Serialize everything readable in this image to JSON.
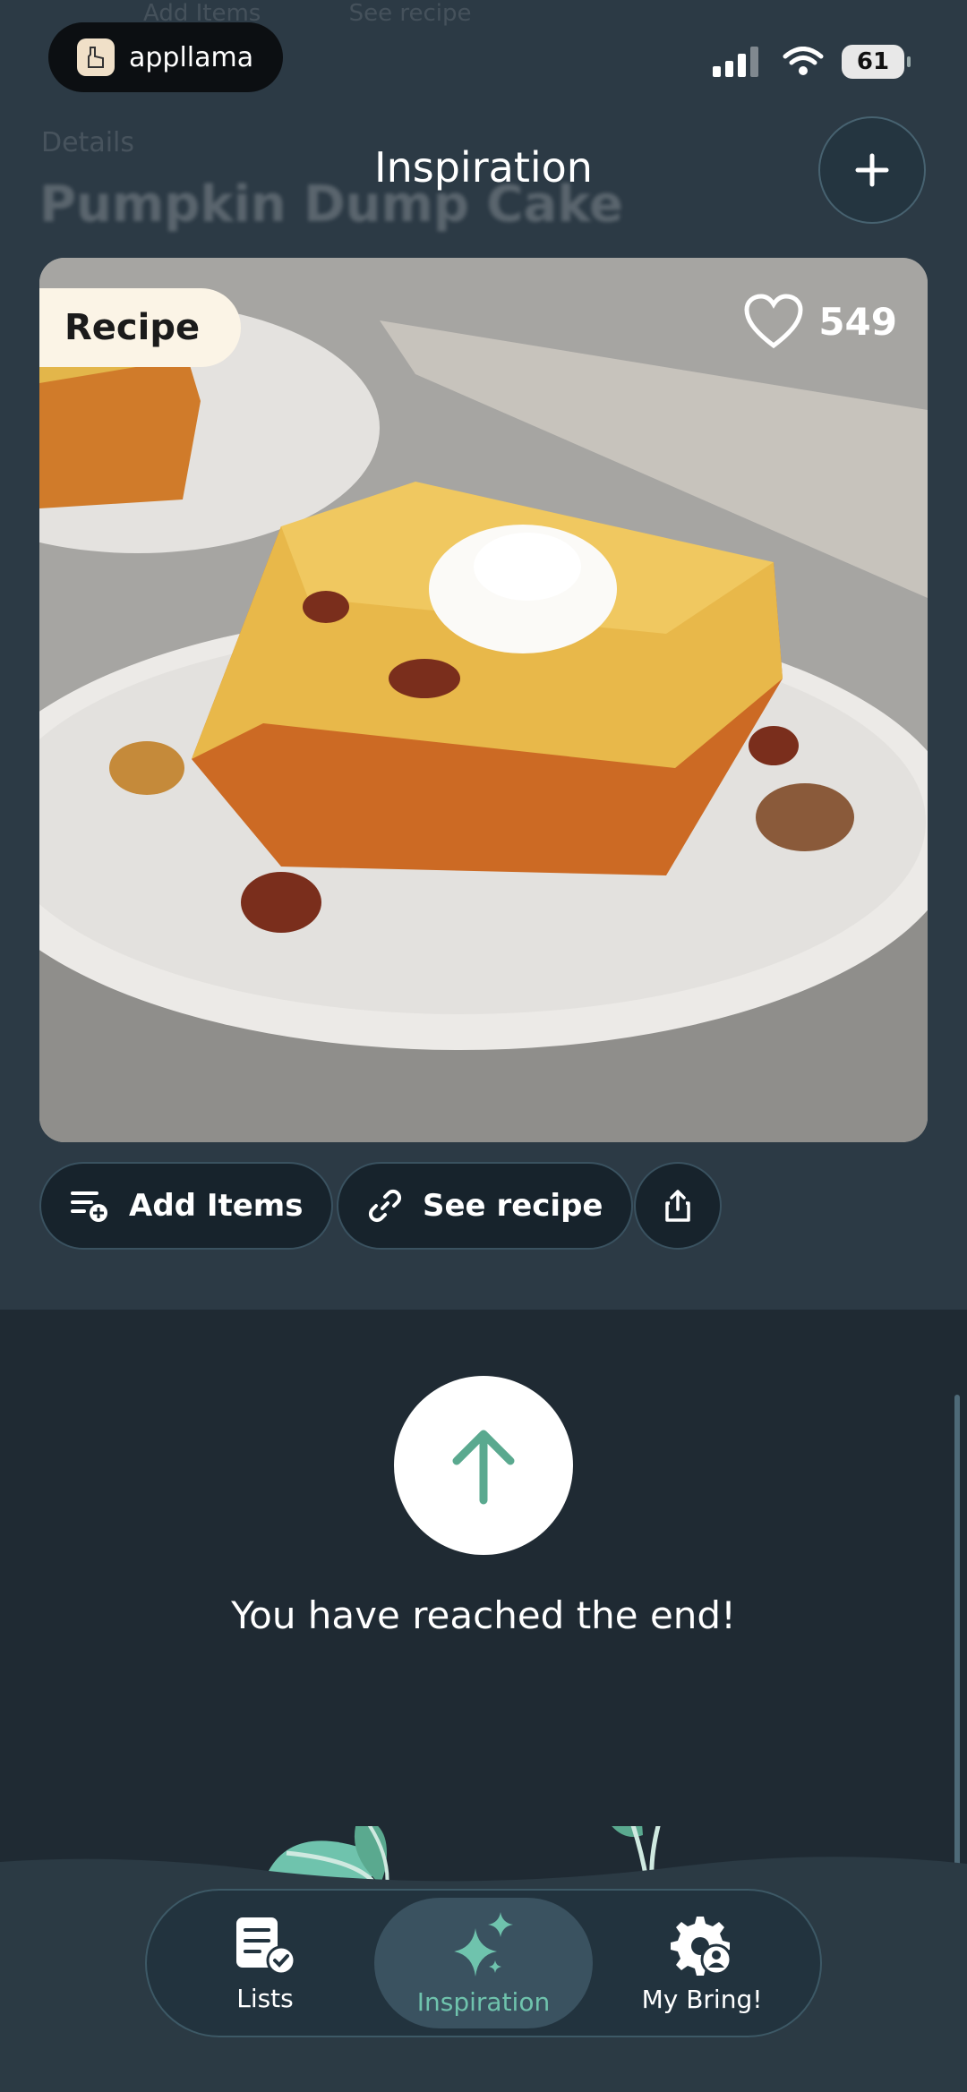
{
  "status": {
    "app_pill": "appllama",
    "battery": "61"
  },
  "background_ghost": {
    "row": [
      "Add Items",
      "See recipe"
    ],
    "label": "Details",
    "title": "Pumpkin Dump Cake"
  },
  "header": {
    "title": "Inspiration"
  },
  "card": {
    "badge": "Recipe",
    "likes": "549"
  },
  "actions": {
    "add_items": "Add Items",
    "see_recipe": "See recipe"
  },
  "end": {
    "message": "You have reached the end!"
  },
  "tabs": [
    {
      "label": "Lists"
    },
    {
      "label": "Inspiration"
    },
    {
      "label": "My Bring!"
    }
  ],
  "colors": {
    "accent": "#6fc3ad",
    "background": "#1f2a33",
    "surface": "#2c3a45"
  }
}
